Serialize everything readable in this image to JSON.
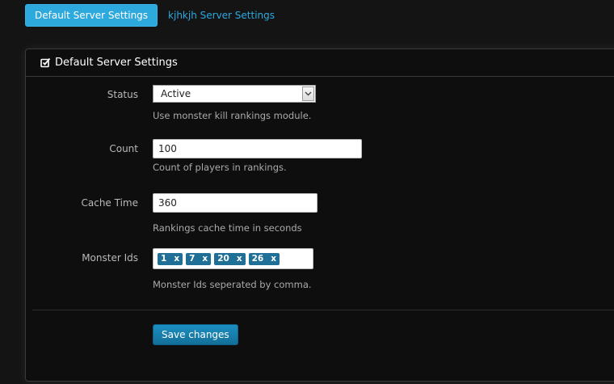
{
  "tabs": [
    {
      "label": "Default Server Settings",
      "active": true
    },
    {
      "label": "kjhkjh Server Settings",
      "active": false
    }
  ],
  "panel": {
    "title": "Default Server Settings",
    "title_icon": "edit-checkbox-icon"
  },
  "form": {
    "status": {
      "label": "Status",
      "value": "Active",
      "help": "Use monster kill rankings module."
    },
    "count": {
      "label": "Count",
      "value": "100",
      "help": "Count of players in rankings."
    },
    "cache_time": {
      "label": "Cache Time",
      "value": "360",
      "help": "Rankings cache time in seconds"
    },
    "monster_ids": {
      "label": "Monster Ids",
      "tags": [
        "1",
        "7",
        "20",
        "26"
      ],
      "remove_glyph": "x",
      "help": "Monster Ids seperated by comma."
    }
  },
  "actions": {
    "save_label": "Save changes"
  },
  "colors": {
    "background": "#141414",
    "accent": "#2ea9dd",
    "tag": "#1f6f96",
    "button": "#1a86b8"
  }
}
